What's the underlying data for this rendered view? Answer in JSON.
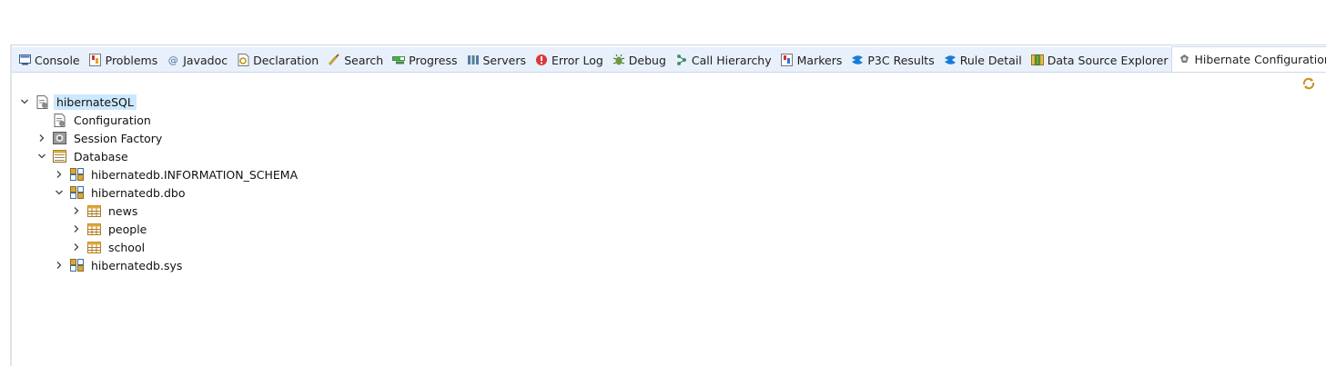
{
  "tabs": [
    {
      "label": "Console",
      "icon": "console-icon"
    },
    {
      "label": "Problems",
      "icon": "problems-icon"
    },
    {
      "label": "Javadoc",
      "icon": "javadoc-icon"
    },
    {
      "label": "Declaration",
      "icon": "declaration-icon"
    },
    {
      "label": "Search",
      "icon": "search-icon"
    },
    {
      "label": "Progress",
      "icon": "progress-icon"
    },
    {
      "label": "Servers",
      "icon": "servers-icon"
    },
    {
      "label": "Error Log",
      "icon": "error-log-icon"
    },
    {
      "label": "Debug",
      "icon": "debug-icon"
    },
    {
      "label": "Call Hierarchy",
      "icon": "call-hierarchy-icon"
    },
    {
      "label": "Markers",
      "icon": "markers-icon"
    },
    {
      "label": "P3C Results",
      "icon": "p3c-icon"
    },
    {
      "label": "Rule Detail",
      "icon": "p3c-icon"
    },
    {
      "label": "Data Source Explorer",
      "icon": "data-source-icon"
    },
    {
      "label": "Hibernate Configurations",
      "icon": "hibernate-icon",
      "active": true
    }
  ],
  "tree": {
    "root": "hibernateSQL",
    "configuration": "Configuration",
    "session_factory": "Session Factory",
    "database": "Database",
    "schema_info": "hibernatedb.INFORMATION_SCHEMA",
    "schema_dbo": "hibernatedb.dbo",
    "table_news": "news",
    "table_people": "people",
    "table_school": "school",
    "schema_sys": "hibernatedb.sys"
  },
  "colors": {
    "tabbar_bg": "#e8f0fb",
    "selection_bg": "#cce8ff"
  }
}
